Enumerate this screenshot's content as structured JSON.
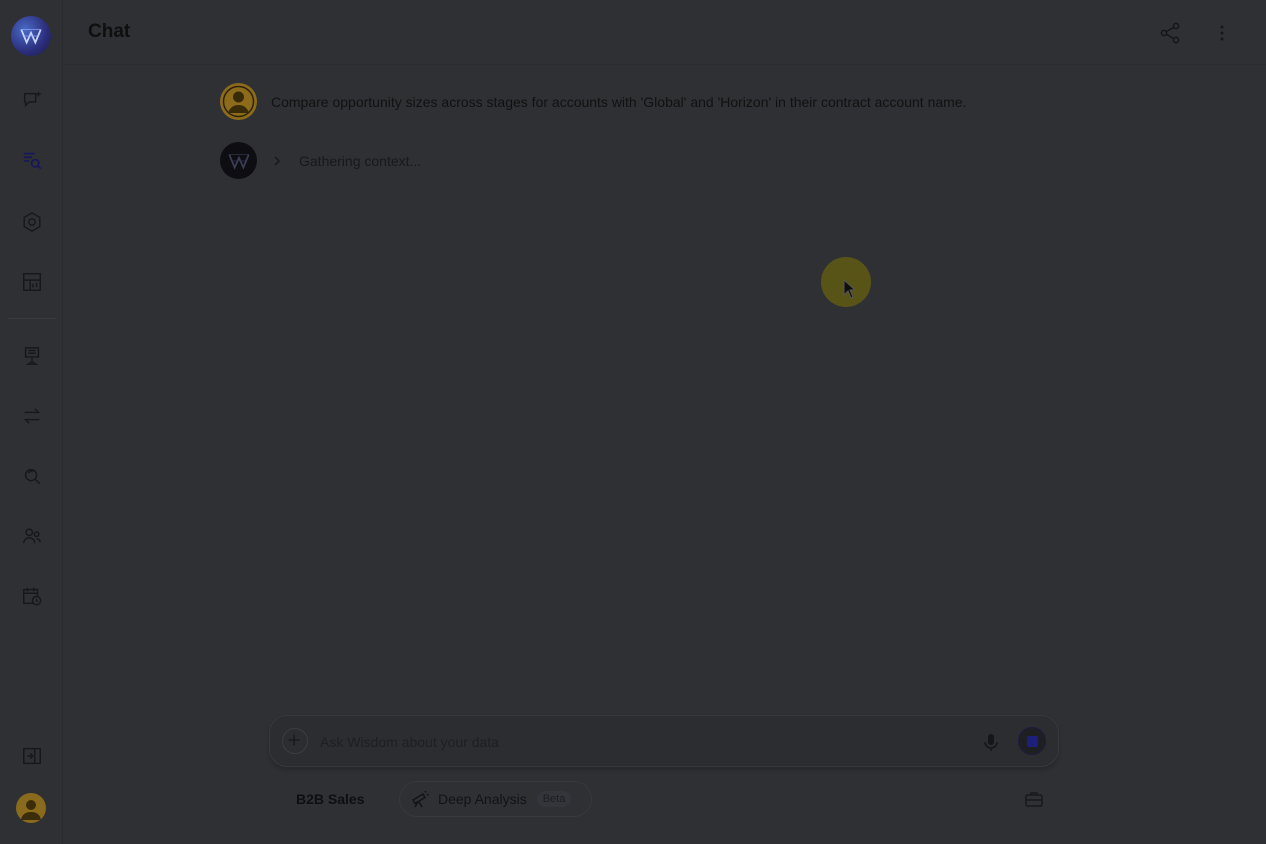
{
  "header": {
    "title": "Chat"
  },
  "conversation": {
    "user_message": "Compare opportunity sizes across stages for accounts with 'Global' and 'Horizon' in their contract account name.",
    "assistant_status": "Gathering context..."
  },
  "composer": {
    "placeholder": "Ask Wisdom about your data"
  },
  "footer": {
    "context_label": "B2B Sales",
    "deep_analysis_label": "Deep Analysis",
    "beta_badge": "Beta"
  },
  "sidebar": {
    "icons": [
      "new-chat-icon",
      "search-list-icon",
      "settings-cog-icon",
      "dashboard-icon",
      "pipeline-icon",
      "transfer-icon",
      "refresh-search-icon",
      "users-icon",
      "calendar-clock-icon",
      "collapse-sidebar-icon"
    ]
  },
  "colors": {
    "background": "#2f3034",
    "accent": "#1d1f7c",
    "cursor_highlight": "#5f5a14"
  }
}
